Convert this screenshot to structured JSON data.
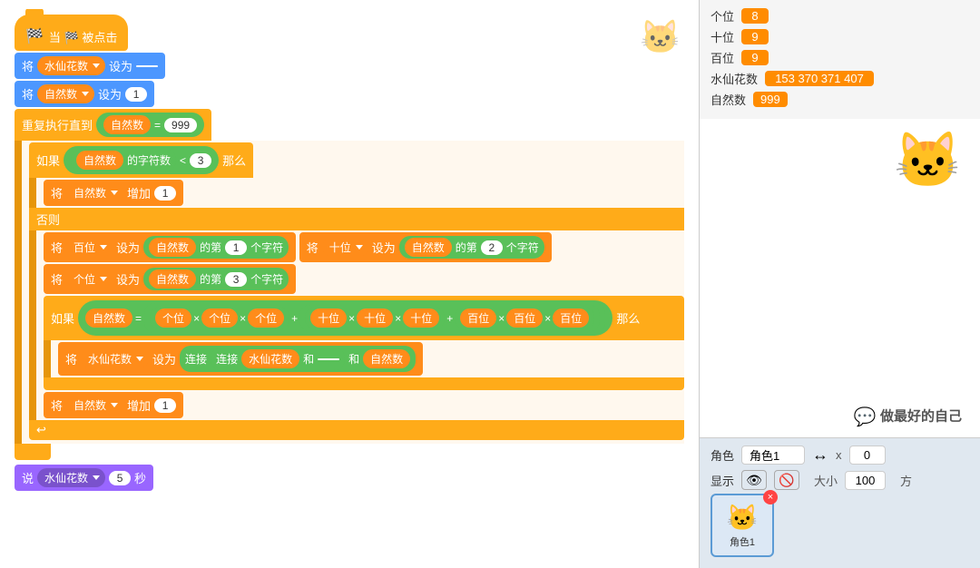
{
  "blocks": {
    "event_flag": "当 🏁 被点击",
    "set_narcissus": "将",
    "narcissus_var": "水仙花数",
    "set_to": "设为",
    "set_natural": "将",
    "natural_var": "自然数",
    "set_to2": "设为",
    "natural_val": "1",
    "repeat_until": "重复执行直到",
    "natural_eq": "自然数",
    "eq_sign": "=",
    "eq_val": "999",
    "if_label": "如果",
    "strlen_of": "的字符数",
    "lt_sign": "<",
    "lt_val": "3",
    "then_label": "那么",
    "natural_increase": "自然数",
    "increase_by": "增加",
    "inc_val": "1",
    "else_label": "否则",
    "set_hundreds": "将",
    "hundreds_var": "百位",
    "set_to_label": "设为",
    "natural_of": "自然数",
    "the_label": "的第",
    "pos1": "1",
    "char_label": "个字符",
    "set_tens": "将",
    "tens_var": "十位",
    "set_to_label2": "设为",
    "natural_of2": "自然数",
    "the_label2": "的第",
    "pos2": "2",
    "char_label2": "个字符",
    "set_units": "将",
    "units_var": "个位",
    "set_to_label3": "设为",
    "natural_of3": "自然数",
    "the_label3": "的第",
    "pos3": "3",
    "char_label3": "个字符",
    "if2_label": "如果",
    "natural_var2": "自然数",
    "eq_sign2": "=",
    "units_v": "个位",
    "mul": "×",
    "units_v2": "个位",
    "mul2": "×",
    "units_v3": "个位",
    "plus": "+",
    "tens_v": "十位",
    "mul3": "×",
    "tens_v2": "十位",
    "mul4": "×",
    "tens_v3": "十位",
    "plus2": "+",
    "hundreds_v": "百位",
    "mul5": "×",
    "hundreds_v2": "百位",
    "mul6": "×",
    "hundreds_v3": "百位",
    "then2_label": "那么",
    "set_narcissus2": "将",
    "narcissus_var2": "水仙花数",
    "set_to_join": "设为",
    "join_label": "连接",
    "join_label2": "连接",
    "narcissus_v": "水仙花数",
    "and_label": "和",
    "space_val": "",
    "and2_label": "和",
    "natural_v": "自然数",
    "natural_increase2": "自然数",
    "increase_by2": "增加",
    "inc_val2": "1",
    "say_label": "说",
    "narcissus_say": "水仙花数",
    "say_secs": "5",
    "say_sec_label": "秒"
  },
  "variables": {
    "units_label": "个位",
    "units_value": "8",
    "tens_label": "十位",
    "tens_value": "9",
    "hundreds_label": "百位",
    "hundreds_value": "9",
    "narcissus_label": "水仙花数",
    "narcissus_value": "153 370 371 407",
    "natural_label": "自然数",
    "natural_value": "999"
  },
  "controls": {
    "sprite_label": "角色",
    "sprite_name": "角色1",
    "x_label": "x",
    "x_value": "0",
    "show_label": "显示",
    "size_label": "大小",
    "size_value": "100",
    "direction_label": "方"
  },
  "sprite": {
    "name": "角色1",
    "delete_btn": "×"
  },
  "watermark": {
    "icon": "💬",
    "text": "做最好的自己"
  },
  "colors": {
    "orange": "#ffab19",
    "green": "#59c059",
    "blue": "#4c97ff",
    "purple": "#9966ff",
    "var_orange": "#ff8c1a"
  }
}
